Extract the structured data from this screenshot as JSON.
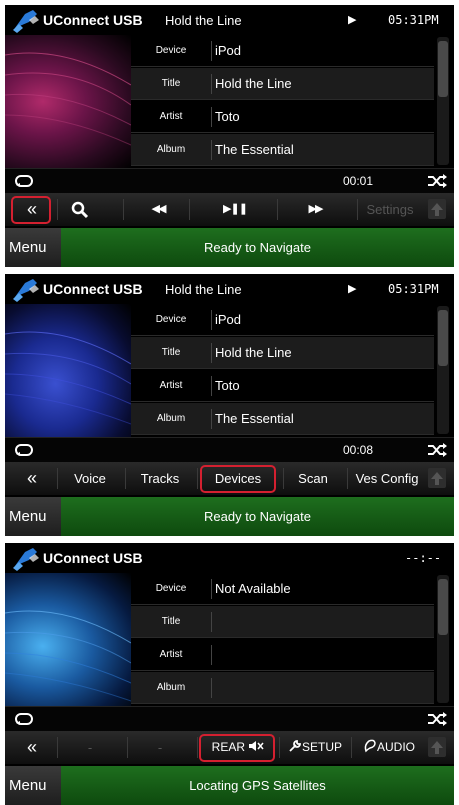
{
  "colors": {
    "background": "#000000",
    "nav_green": "#165c16",
    "highlight_red": "#d42030",
    "text": "#ffffff"
  },
  "screens": [
    {
      "source_label": "UConnect USB",
      "track_title_top": "Hold the Line",
      "play_indicator": "▶",
      "clock": "05:31PM",
      "art_style": "red",
      "info": [
        {
          "key": "Device",
          "value": "iPod"
        },
        {
          "key": "Title",
          "value": "Hold the Line"
        },
        {
          "key": "Artist",
          "value": "Toto"
        },
        {
          "key": "Album",
          "value": "The Essential"
        }
      ],
      "time": "00:01",
      "toolbar": {
        "back": "«",
        "search_icon": "search-icon",
        "prev": "◀◀",
        "play_pause": "▶❚❚",
        "next": "▶▶",
        "settings": "Settings"
      },
      "menu": "Menu",
      "nav_status": "Ready to Navigate"
    },
    {
      "source_label": "UConnect USB",
      "track_title_top": "Hold the Line",
      "play_indicator": "▶",
      "clock": "05:31PM",
      "art_style": "blue",
      "info": [
        {
          "key": "Device",
          "value": "iPod"
        },
        {
          "key": "Title",
          "value": "Hold the Line"
        },
        {
          "key": "Artist",
          "value": "Toto"
        },
        {
          "key": "Album",
          "value": "The Essential"
        }
      ],
      "time": "00:08",
      "toolbar": {
        "back": "«",
        "voice": "Voice",
        "tracks": "Tracks",
        "devices": "Devices",
        "scan": "Scan",
        "ves_config": "Ves Config"
      },
      "menu": "Menu",
      "nav_status": "Ready to Navigate"
    },
    {
      "source_label": "UConnect USB",
      "clock": "--:--",
      "art_style": "blue2",
      "info": [
        {
          "key": "Device",
          "value": "Not Available"
        },
        {
          "key": "Title",
          "value": ""
        },
        {
          "key": "Artist",
          "value": ""
        },
        {
          "key": "Album",
          "value": ""
        }
      ],
      "toolbar": {
        "back": "«",
        "rear": "REAR",
        "rear_mute_icon": "speaker-mute-icon",
        "setup": "SETUP",
        "audio": "AUDIO"
      },
      "menu": "Menu",
      "nav_status": "Locating GPS Satellites"
    }
  ]
}
